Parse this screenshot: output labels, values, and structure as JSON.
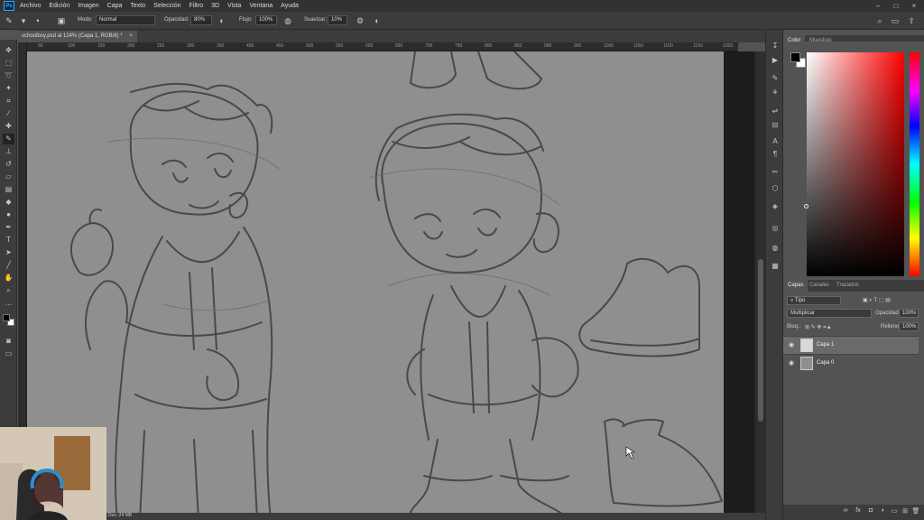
{
  "menubar": {
    "app_icon": "Ps",
    "items": [
      "Archivo",
      "Edición",
      "Imagen",
      "Capa",
      "Texto",
      "Selección",
      "Filtro",
      "3D",
      "Vista",
      "Ventana",
      "Ayuda"
    ],
    "window_controls": [
      "minimize-icon",
      "maximize-icon",
      "close-icon"
    ]
  },
  "options": {
    "modo_label": "Modo:",
    "modo_value": "Normal",
    "opacidad_label": "Opacidad:",
    "opacidad_value": "80%",
    "flujo_label": "Flujo:",
    "flujo_value": "100%",
    "suavizar_label": "Suavizar:",
    "suavizar_value": "10%"
  },
  "document": {
    "tab_title": "schoolboy.psd al 124% (Capa 1, RGB/8) *",
    "tab_close": "×",
    "status": "Doc: 24 MB"
  },
  "ruler": {
    "ticks": [
      "50",
      "100",
      "150",
      "200",
      "250",
      "300",
      "350",
      "400",
      "450",
      "500",
      "550",
      "600",
      "650",
      "700",
      "750",
      "800",
      "850",
      "900",
      "950",
      "1000",
      "1050",
      "1100",
      "1150",
      "1200"
    ]
  },
  "color_panel": {
    "tabs": [
      "Color",
      "Muestras"
    ],
    "foreground": "#000000",
    "background": "#ffffff",
    "hue": "#ff0000"
  },
  "layers_panel": {
    "tabs": [
      "Capas",
      "Canales",
      "Trazados"
    ],
    "filter_placeholder": "Tipo",
    "blend_mode": "Multiplicar",
    "opacity_label": "Opacidad:",
    "opacity_value": "100%",
    "lock_label": "Bloq.:",
    "fill_label": "Relleno:",
    "fill_value": "100%",
    "layers": [
      {
        "name": "Capa 1",
        "visible": true,
        "selected": true
      },
      {
        "name": "Capa 0",
        "visible": true,
        "selected": false
      }
    ]
  }
}
